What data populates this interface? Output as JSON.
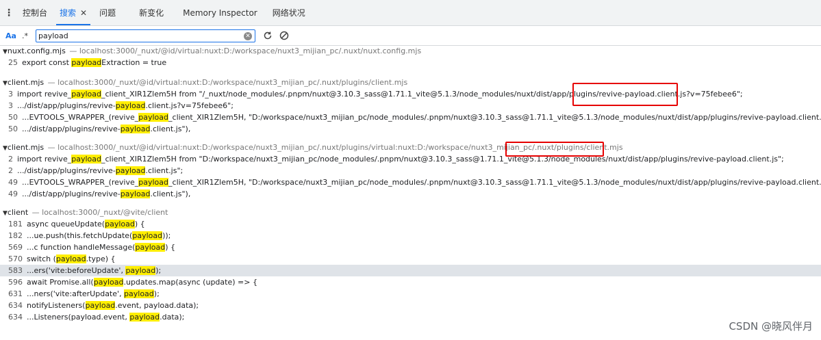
{
  "tabbar": {
    "tabs": [
      {
        "label": "控制台",
        "active": false,
        "closable": false
      },
      {
        "label": "搜索",
        "active": true,
        "closable": true
      },
      {
        "label": "问题",
        "active": false,
        "closable": false
      },
      {
        "label": "新变化",
        "active": false,
        "closable": false
      },
      {
        "label": "Memory Inspector",
        "active": false,
        "closable": false
      },
      {
        "label": "网络状况",
        "active": false,
        "closable": false
      }
    ]
  },
  "search": {
    "match_case_label": "Aa",
    "regex_label": ".*",
    "value": "payload"
  },
  "results": [
    {
      "file": "nuxt.config.mjs",
      "path": "localhost:3000/_nuxt/@id/virtual:nuxt:D:/workspace/nuxt3_mijian_pc/.nuxt/nuxt.config.mjs",
      "matches": [
        {
          "line": "25",
          "pre": "export const ",
          "hit": "payload",
          "post": "Extraction = true"
        }
      ]
    },
    {
      "file": "client.mjs",
      "path": "localhost:3000/_nuxt/@id/virtual:nuxt:D:/workspace/nuxt3_mijian_pc/.nuxt/plugins/client.mjs",
      "matches": [
        {
          "line": "3",
          "pre": "import revive_",
          "hit": "payload",
          "post": "_client_XIR1Zlem5H from \"/_nuxt/node_modules/.pnpm/nuxt@3.10.3_sass@1.71.1_vite@5.1.3/node_modules/nuxt/dist/app/plugins/revive-payload.client.js?v=75febee6\";"
        },
        {
          "line": "3",
          "pre": ".../dist/app/plugins/revive-",
          "hit": "payload",
          "post": ".client.js?v=75febee6\";"
        },
        {
          "line": "50",
          "pre": "...EVTOOLS_WRAPPER_(revive_",
          "hit": "payload",
          "post": "_client_XIR1Zlem5H, \"D:/workspace/nuxt3_mijian_pc/node_modules/.pnpm/nuxt@3.10.3_sass@1.71.1_vite@5.1.3/node_modules/nuxt/dist/app/plugins/revive-payload.client.js\"),"
        },
        {
          "line": "50",
          "pre": ".../dist/app/plugins/revive-",
          "hit": "payload",
          "post": ".client.js\"),"
        }
      ]
    },
    {
      "file": "client.mjs",
      "path": "localhost:3000/_nuxt/@id/virtual:nuxt:D:/workspace/nuxt3_mijian_pc/.nuxt/plugins/virtual:nuxt:D:/workspace/nuxt3_mijian_pc/.nuxt/plugins/client.mjs",
      "matches": [
        {
          "line": "2",
          "pre": "import revive_",
          "hit": "payload",
          "post": "_client_XIR1Zlem5H from \"D:/workspace/nuxt3_mijian_pc/node_modules/.pnpm/nuxt@3.10.3_sass@1.71.1_vite@5.1.3/node_modules/nuxt/dist/app/plugins/revive-payload.client.js\";"
        },
        {
          "line": "2",
          "pre": ".../dist/app/plugins/revive-",
          "hit": "payload",
          "post": ".client.js\";"
        },
        {
          "line": "49",
          "pre": "...EVTOOLS_WRAPPER_(revive_",
          "hit": "payload",
          "post": "_client_XIR1Zlem5H, \"D:/workspace/nuxt3_mijian_pc/node_modules/.pnpm/nuxt@3.10.3_sass@1.71.1_vite@5.1.3/node_modules/nuxt/dist/app/plugins/revive-payload.client.js\"),"
        },
        {
          "line": "49",
          "pre": ".../dist/app/plugins/revive-",
          "hit": "payload",
          "post": ".client.js\"),"
        }
      ]
    },
    {
      "file": "client",
      "path": "localhost:3000/_nuxt/@vite/client",
      "matches": [
        {
          "line": "181",
          "pre": "async queueUpdate(",
          "hit": "payload",
          "post": ") {"
        },
        {
          "line": "182",
          "pre": "...ue.push(this.fetchUpdate(",
          "hit": "payload",
          "post": "));"
        },
        {
          "line": "569",
          "pre": "...c function handleMessage(",
          "hit": "payload",
          "post": ") {"
        },
        {
          "line": "570",
          "pre": "switch (",
          "hit": "payload",
          "post": ".type) {"
        },
        {
          "line": "583",
          "pre": "...ers('vite:beforeUpdate', ",
          "hit": "payload",
          "post": ");",
          "selected": true
        },
        {
          "line": "596",
          "pre": "await Promise.all(",
          "hit": "payload",
          "post": ".updates.map(async (update) => {"
        },
        {
          "line": "631",
          "pre": "...ners('vite:afterUpdate', ",
          "hit": "payload",
          "post": ");"
        },
        {
          "line": "634",
          "pre": "notifyListeners(",
          "hit": "payload",
          "post": ".event, payload.data);"
        },
        {
          "line": "634",
          "pre": "...Listeners(payload.event, ",
          "hit": "payload",
          "post": ".data);"
        }
      ]
    }
  ],
  "watermark": "CSDN @晓风伴月",
  "annotation_color": "#e60000"
}
